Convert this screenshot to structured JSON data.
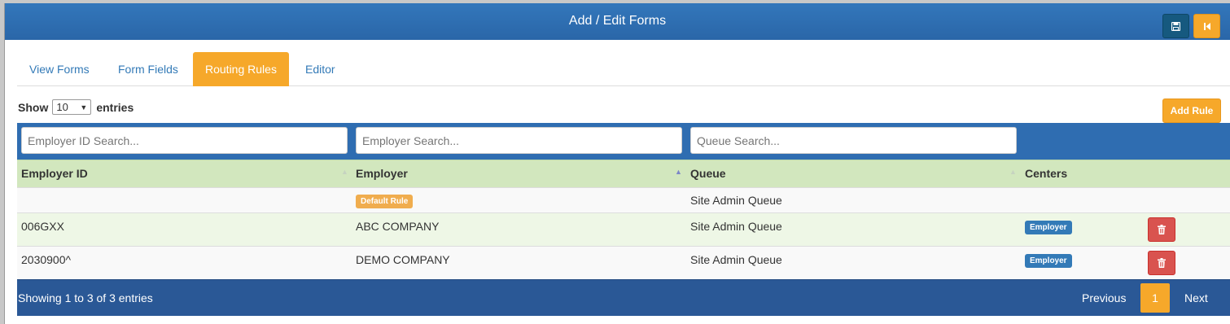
{
  "header": {
    "title": "Add / Edit Forms",
    "save_icon": "save-icon",
    "back_icon": "step-backward-icon"
  },
  "tabs": [
    {
      "label": "View Forms",
      "active": false
    },
    {
      "label": "Form Fields",
      "active": false
    },
    {
      "label": "Routing Rules",
      "active": true
    },
    {
      "label": "Editor",
      "active": false
    }
  ],
  "length": {
    "show_label": "Show",
    "value": "10",
    "entries_label": "entries"
  },
  "add_rule_label": "Add Rule",
  "search": {
    "employer_id_placeholder": "Employer ID Search...",
    "employer_placeholder": "Employer Search...",
    "queue_placeholder": "Queue Search..."
  },
  "columns": {
    "employer_id": "Employer ID",
    "employer": "Employer",
    "queue": "Queue",
    "centers": "Centers"
  },
  "rows": [
    {
      "employer_id": "",
      "employer_badge": "Default Rule",
      "queue": "Site Admin Queue"
    },
    {
      "employer_id": "006GXX",
      "employer": "ABC COMPANY",
      "queue": "Site Admin Queue",
      "center": "Employer"
    },
    {
      "employer_id": "2030900^",
      "employer": "DEMO COMPANY",
      "queue": "Site Admin Queue",
      "center": "Employer"
    }
  ],
  "footer": {
    "info": "Showing 1 to 3 of 3 entries",
    "previous": "Previous",
    "current_page": "1",
    "next": "Next"
  },
  "colors": {
    "primary": "#2f6db1",
    "accent": "#f6a82a",
    "header_row": "#d2e7be",
    "danger": "#d9534f"
  }
}
